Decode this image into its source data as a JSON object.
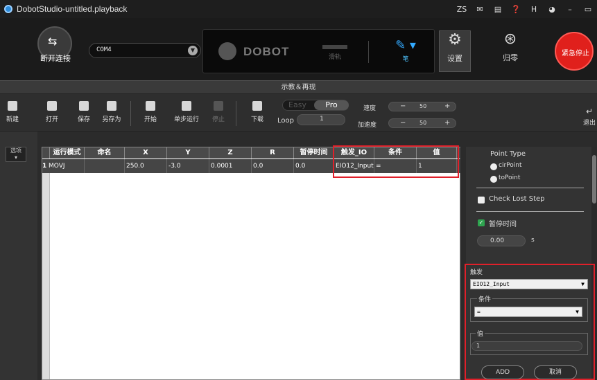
{
  "window": {
    "title": "DobotStudio-untitled.playback",
    "controls": [
      "ZS",
      "✉",
      "▤",
      "❓",
      "H",
      "◕",
      "–",
      "▭"
    ]
  },
  "top": {
    "disconnect_label": "断开连接",
    "com_port": "COM4",
    "brand": "DOBOT",
    "rail_label": "滑轨",
    "pen_label": "笔",
    "settings_label": "设置",
    "home_label": "归零",
    "estop_label": "紧急停止"
  },
  "section_title": "示教＆再现",
  "toolbar": {
    "new": "新建",
    "open": "打开",
    "save": "保存",
    "save_as": "另存为",
    "start": "开始",
    "step": "单步运行",
    "stop": "停止",
    "download": "下载",
    "mode_easy": "Easy",
    "mode_pro": "Pro",
    "loop_label": "Loop",
    "loop_value": "1",
    "speed_label": "速度",
    "speed_value": "50",
    "accel_label": "加速度",
    "accel_value": "50",
    "exit": "退出"
  },
  "options_label": "选项",
  "table": {
    "headers": [
      "运行模式",
      "命名",
      "X",
      "Y",
      "Z",
      "R",
      "暂停时间",
      "触发_IO",
      "条件",
      "值"
    ],
    "rows": [
      {
        "num": "1",
        "cells": [
          "MOVJ",
          "",
          "250.0",
          "-3.0",
          "0.0001",
          "0.0",
          "0.0",
          "EIO12_Input",
          "=",
          "1"
        ]
      }
    ]
  },
  "right_panel": {
    "point_type_label": "Point Type",
    "point_options": [
      "cirPoint",
      "toPoint"
    ],
    "check_lost_step": "Check Lost Step",
    "pause_time_label": "暂停时间",
    "pause_time_value": "0.00",
    "pause_time_unit": "s",
    "trigger_label": "触发",
    "trigger_value": "EIO12_Input",
    "condition_label": "条件",
    "condition_value": "=",
    "value_label": "值",
    "value_value": "1",
    "add_button": "ADD",
    "cancel_button": "取消"
  }
}
